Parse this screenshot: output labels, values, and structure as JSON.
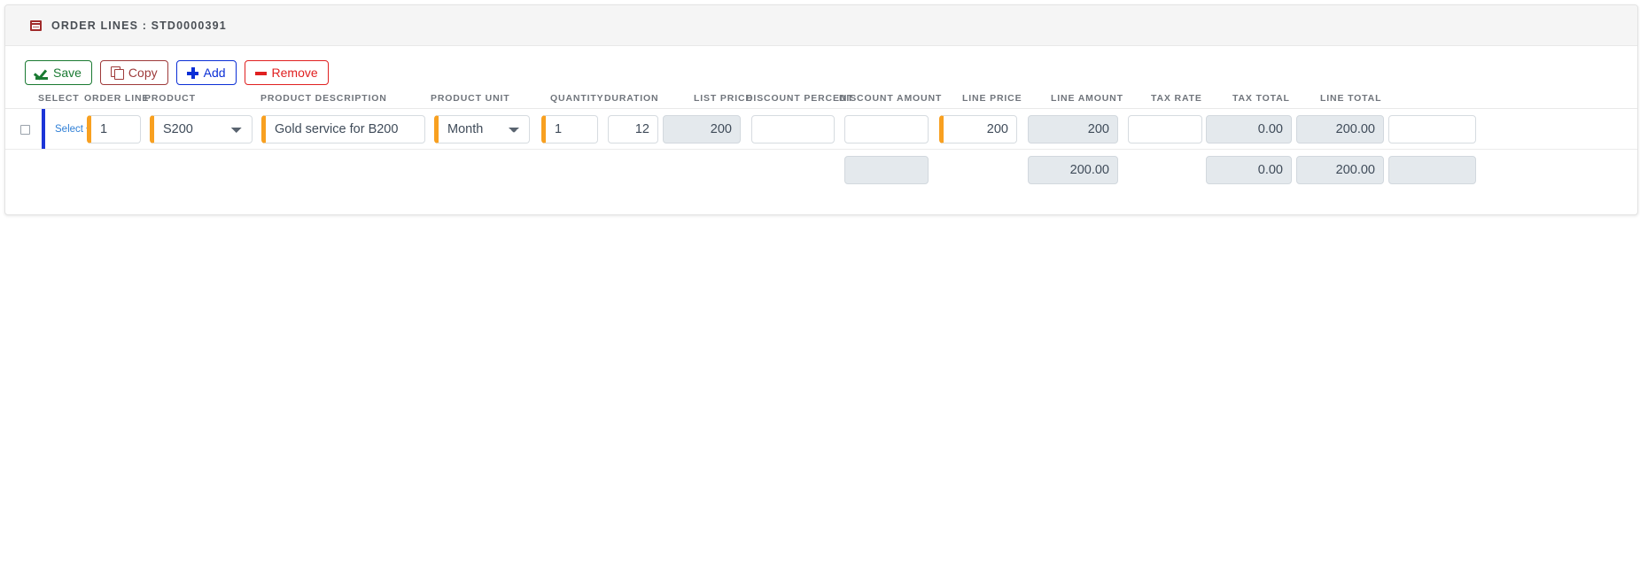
{
  "panel": {
    "icon": "table-icon",
    "title": "ORDER LINES : STD0000391"
  },
  "toolbar": {
    "buttons": [
      {
        "name": "save-button",
        "label": "Save",
        "icon": "save-icon",
        "color": "#1a7a32"
      },
      {
        "name": "copy-button",
        "label": "Copy",
        "icon": "copy-icon",
        "color": "#9e3a3a"
      },
      {
        "name": "add-button",
        "label": "Add",
        "icon": "plus-icon",
        "color": "#0b2fd6"
      },
      {
        "name": "remove-button",
        "label": "Remove",
        "icon": "minus-icon",
        "color": "#e02020"
      }
    ]
  },
  "grid": {
    "columns": [
      {
        "key": "select",
        "label": "SELECT"
      },
      {
        "key": "order_line",
        "label": "ORDER LINE"
      },
      {
        "key": "product",
        "label": "PRODUCT"
      },
      {
        "key": "product_description",
        "label": "PRODUCT DESCRIPTION"
      },
      {
        "key": "product_unit",
        "label": "PRODUCT UNIT"
      },
      {
        "key": "quantity",
        "label": "QUANTITY"
      },
      {
        "key": "duration",
        "label": "DURATION"
      },
      {
        "key": "list_price",
        "label": "LIST PRICE"
      },
      {
        "key": "discount_percent",
        "label": "DISCOUNT PERCENT"
      },
      {
        "key": "discount_amount",
        "label": "DISCOUNT AMOUNT"
      },
      {
        "key": "line_price",
        "label": "LINE PRICE"
      },
      {
        "key": "line_amount",
        "label": "LINE AMOUNT"
      },
      {
        "key": "tax_rate",
        "label": "TAX RATE"
      },
      {
        "key": "tax_total",
        "label": "TAX TOTAL"
      },
      {
        "key": "line_total",
        "label": "LINE TOTAL"
      }
    ],
    "row": {
      "select_label": "Select",
      "selected": false,
      "order_line": "1",
      "product": "S200",
      "product_description": "Gold service for B200",
      "product_unit": "Month",
      "quantity": "1",
      "duration": "12",
      "list_price": "200",
      "discount_percent": "",
      "discount_amount": "",
      "line_price": "200",
      "line_amount": "200",
      "tax_rate": "",
      "tax_total": "0.00",
      "line_total": "200.00",
      "overflow": ""
    },
    "totals": {
      "discount_amount": "",
      "line_amount": "200.00",
      "tax_total": "0.00",
      "line_total": "200.00",
      "overflow": ""
    }
  },
  "accent": {
    "required_marker": "#f8a020",
    "row_marker": "#1c35d8",
    "readonly_bg": "#e4e9ed",
    "link": "#2f7fd6"
  }
}
